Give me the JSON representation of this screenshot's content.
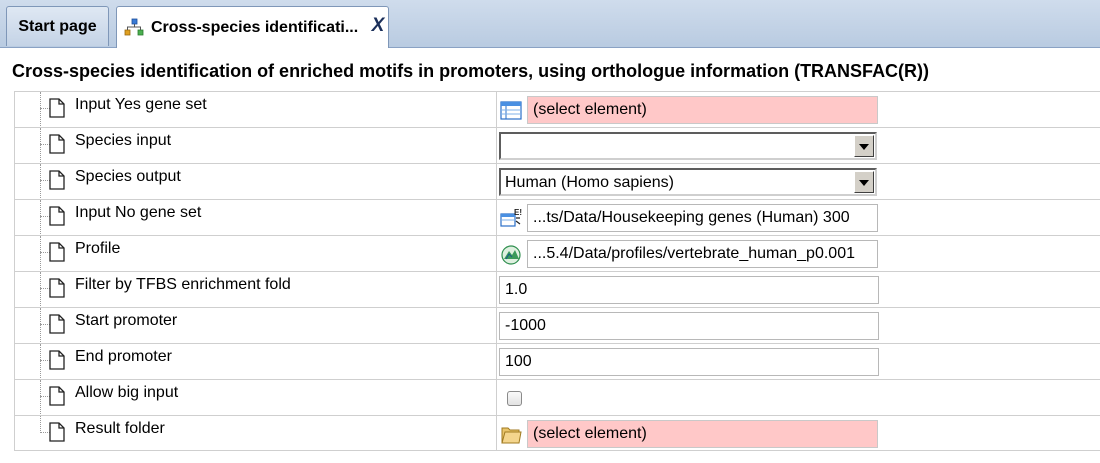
{
  "tabs": [
    {
      "label": "Start page"
    },
    {
      "label": "Cross-species identificati...",
      "close_label": "X",
      "icon": "workflow-icon"
    }
  ],
  "title": "Cross-species identification of enriched motifs in promoters, using orthologue information (TRANSFAC(R))",
  "params": [
    {
      "label": "Input Yes gene set",
      "value": "(select element)",
      "kind": "element-picker",
      "icon": "table-icon",
      "state": "required"
    },
    {
      "label": "Species input",
      "value": "",
      "kind": "dropdown"
    },
    {
      "label": "Species output",
      "value": "Human (Homo sapiens)",
      "kind": "dropdown"
    },
    {
      "label": "Input No gene set",
      "value": "...ts/Data/Housekeeping genes (Human) 300",
      "kind": "element-picker",
      "icon": "gene-set-icon"
    },
    {
      "label": "Profile",
      "value": "...5.4/Data/profiles/vertebrate_human_p0.001",
      "kind": "element-picker",
      "icon": "profile-icon"
    },
    {
      "label": "Filter by TFBS enrichment fold",
      "value": "1.0",
      "kind": "text"
    },
    {
      "label": "Start promoter",
      "value": "-1000",
      "kind": "text"
    },
    {
      "label": "End promoter",
      "value": "100",
      "kind": "text"
    },
    {
      "label": "Allow big input",
      "value": false,
      "kind": "checkbox"
    },
    {
      "label": "Result folder",
      "value": "(select element)",
      "kind": "element-picker",
      "icon": "folder-icon",
      "state": "required"
    }
  ],
  "colors": {
    "required_bg": "#ffc8c8",
    "tabbar": "#c4d3e6"
  }
}
